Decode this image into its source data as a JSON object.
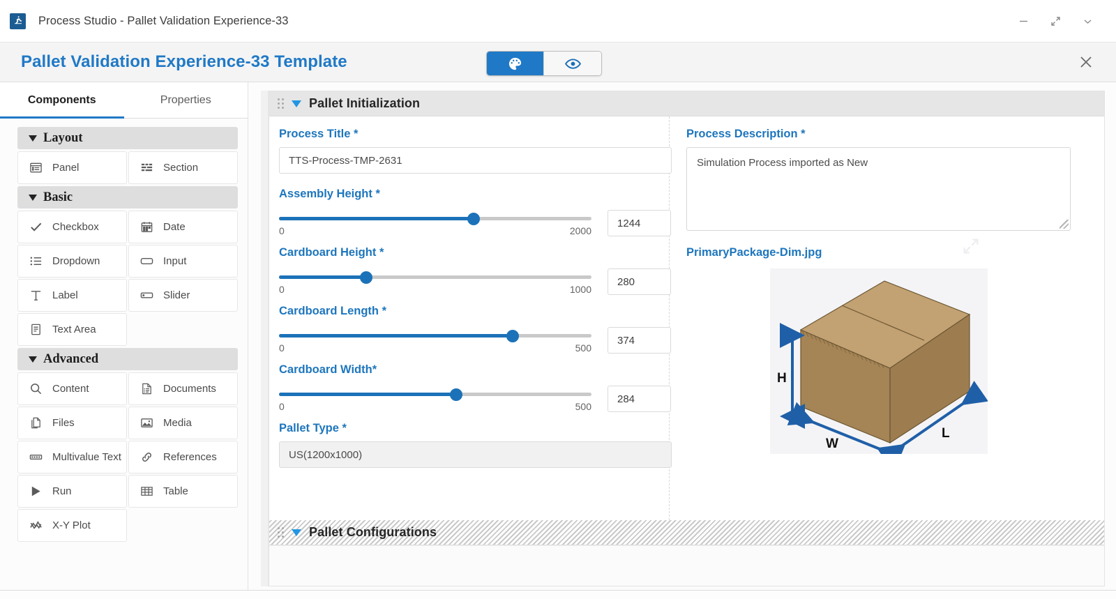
{
  "window": {
    "app_icon": "process-studio-icon",
    "title": "Process Studio - Pallet Validation Experience-33",
    "controls": {
      "minimize": "minimize-icon",
      "maximize": "expand-icon",
      "more": "chevron-down-icon"
    }
  },
  "header": {
    "title": "Pallet Validation Experience-33 Template",
    "mode_toggle": [
      {
        "name": "design-mode",
        "icon": "palette-icon",
        "active": true
      },
      {
        "name": "preview-mode",
        "icon": "eye-icon",
        "active": false
      }
    ],
    "close": "close-icon"
  },
  "sidebar": {
    "tabs": [
      {
        "label": "Components",
        "active": true
      },
      {
        "label": "Properties",
        "active": false
      }
    ],
    "groups": [
      {
        "name": "Layout",
        "title": "Layout",
        "items": [
          {
            "label": "Panel",
            "icon": "panel-icon"
          },
          {
            "label": "Section",
            "icon": "section-icon"
          }
        ]
      },
      {
        "name": "Basic",
        "title": "Basic",
        "items": [
          {
            "label": "Checkbox",
            "icon": "check-icon"
          },
          {
            "label": "Date",
            "icon": "calendar-icon"
          },
          {
            "label": "Dropdown",
            "icon": "list-icon"
          },
          {
            "label": "Input",
            "icon": "input-icon"
          },
          {
            "label": "Label",
            "icon": "text-t-icon"
          },
          {
            "label": "Slider",
            "icon": "slider-icon"
          },
          {
            "label": "Text Area",
            "icon": "textarea-icon"
          }
        ]
      },
      {
        "name": "Advanced",
        "title": "Advanced",
        "items": [
          {
            "label": "Content",
            "icon": "search-icon"
          },
          {
            "label": "Documents",
            "icon": "document-icon"
          },
          {
            "label": "Files",
            "icon": "files-icon"
          },
          {
            "label": "Media",
            "icon": "media-image-icon"
          },
          {
            "label": "Multivalue Text",
            "icon": "multivalue-icon"
          },
          {
            "label": "References",
            "icon": "link-icon"
          },
          {
            "label": "Run",
            "icon": "play-icon"
          },
          {
            "label": "Table",
            "icon": "table-icon"
          },
          {
            "label": "X-Y Plot",
            "icon": "xy-plot-icon"
          }
        ]
      }
    ]
  },
  "form": {
    "sections": [
      {
        "name": "pallet-initialization",
        "title": "Pallet Initialization",
        "expanded": true,
        "striped": false
      },
      {
        "name": "pallet-configurations",
        "title": "Pallet Configurations",
        "expanded": true,
        "striped": true
      }
    ],
    "left": {
      "process_title": {
        "label": "Process Title",
        "required_mark": "*",
        "value": "TTS-Process-TMP-2631"
      },
      "assembly_height": {
        "label": "Assembly Height",
        "required_mark": "*",
        "min": "0",
        "max": "2000",
        "value": "1244",
        "fill_percent": 62.2
      },
      "cardboard_height": {
        "label": "Cardboard Height",
        "required_mark": "*",
        "min": "0",
        "max": "1000",
        "value": "280",
        "fill_percent": 28.0
      },
      "cardboard_length": {
        "label": "Cardboard Length",
        "required_mark": "*",
        "min": "0",
        "max": "500",
        "value": "374",
        "fill_percent": 74.8
      },
      "cardboard_width": {
        "label": "Cardboard Width",
        "required_mark": "*",
        "min": "0",
        "max": "500",
        "value": "284",
        "fill_percent": 56.8
      },
      "pallet_type": {
        "label": "Pallet Type",
        "required_mark": "*",
        "value": "US(1200x1000)"
      }
    },
    "right": {
      "process_description": {
        "label": "Process Description",
        "required_mark": "*",
        "value": "Simulation Process imported as New"
      },
      "media": {
        "label": "PrimaryPackage-Dim.jpg",
        "expand_icon": "expand-image-icon",
        "diagram": {
          "type": "cardboard-box-dimensions",
          "labels": {
            "height": "H",
            "width": "W",
            "length": "L"
          }
        }
      }
    }
  },
  "colors": {
    "accent_blue": "#2079c6",
    "label_blue": "#1d76bd",
    "slider_blue": "#1c72b8",
    "caret_blue": "#2196e3",
    "group_header_gray": "#dededf",
    "section_header_gray": "#e6e6e6",
    "box_front": "#a08050",
    "box_top": "#c3a273",
    "box_side": "#8d7047",
    "dimension_arrow": "#1f5fa8"
  }
}
